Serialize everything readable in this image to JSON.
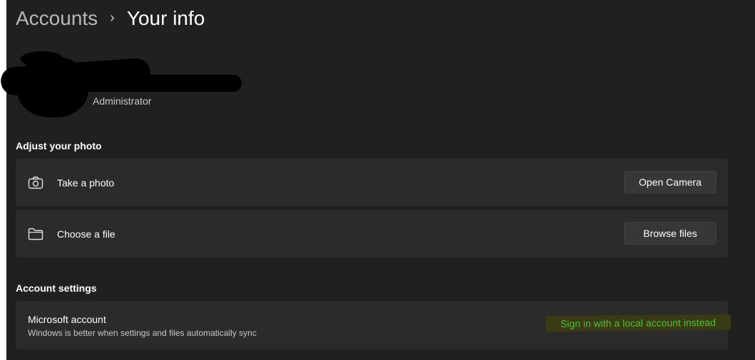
{
  "breadcrumb": {
    "parent": "Accounts",
    "separator": "›",
    "current": "Your info"
  },
  "profile": {
    "role": "Administrator"
  },
  "photo_section": {
    "title": "Adjust your photo",
    "take_photo": {
      "icon": "camera-icon",
      "label": "Take a photo",
      "button_label": "Open Camera"
    },
    "choose_file": {
      "icon": "folder-icon",
      "label": "Choose a file",
      "button_label": "Browse files"
    }
  },
  "account_section": {
    "title": "Account settings",
    "microsoft_account": {
      "title": "Microsoft account",
      "subtitle": "Windows is better when settings and files automatically sync",
      "link_label": "Sign in with a local account instead"
    }
  },
  "colors": {
    "background": "#202020",
    "card": "#2b2b2b",
    "button": "#373737",
    "link": "#4fbf3a",
    "highlight": "#3a3a14"
  }
}
